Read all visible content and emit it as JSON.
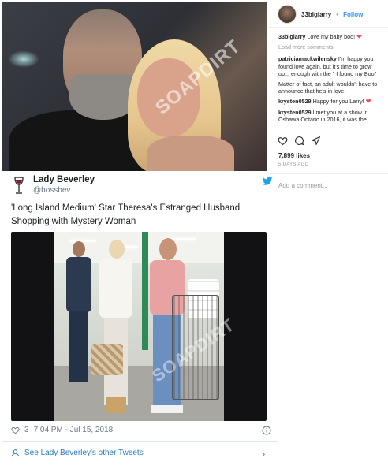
{
  "instagram": {
    "username": "33biglarry",
    "follow_label": "Follow",
    "follow_separator": "•",
    "caption_user": "33biglarry",
    "caption_text": "Love my baby boo!",
    "load_more": "Load more comments",
    "comments": [
      {
        "user": "patriciamackwilensky",
        "text": "I'm happy you found love again, but it's time to grow up... enough with the \" I found my Boo\""
      },
      {
        "user": "",
        "text": "Matter of fact, an adult wouldn't have to announce that he's in love."
      },
      {
        "user": "krysten0529",
        "text": "Happy for you Larry!"
      },
      {
        "user": "krysten0529",
        "text": "I met you at a show in Oshawa Ontario in 2016, it was the"
      }
    ],
    "likes": "7,899 likes",
    "time": "5 DAYS AGO",
    "add_comment_placeholder": "Add a comment...",
    "watermark": "SOAPDIRT"
  },
  "tweet": {
    "display_name": "Lady Beverley",
    "handle": "@bossbev",
    "text": "'Long Island Medium' Star Theresa's Estranged Husband Shopping with Mystery Woman",
    "media_watermark": "SOAPDIRT",
    "like_count": "3",
    "timestamp": "7:04 PM - Jul 15, 2018",
    "see_more": "See Lady Beverley's other Tweets",
    "chevron": "›"
  },
  "colors": {
    "instagram_blue": "#3897f0",
    "heart_red": "#ed4956",
    "twitter_blue": "#1da1f2",
    "link_blue": "#2b7bb9"
  }
}
